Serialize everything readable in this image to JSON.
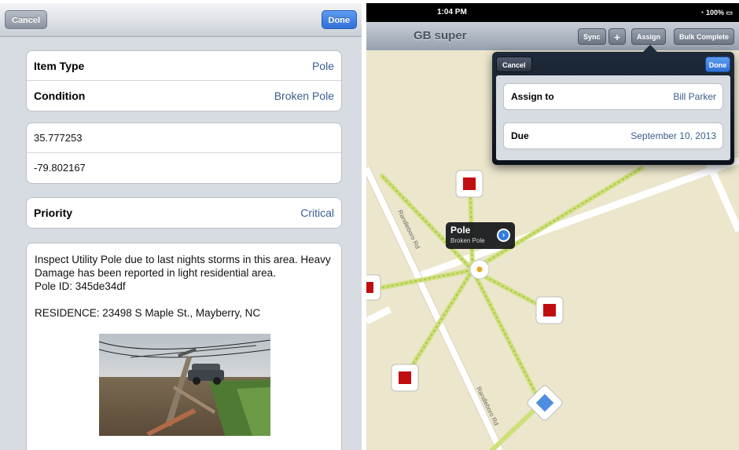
{
  "form": {
    "cancel_label": "Cancel",
    "done_label": "Done",
    "item_type": {
      "label": "Item Type",
      "value": "Pole"
    },
    "condition": {
      "label": "Condition",
      "value": "Broken Pole"
    },
    "latitude": "35.777253",
    "longitude": "-79.802167",
    "priority": {
      "label": "Priority",
      "value": "Critical"
    },
    "notes": {
      "line1": "Inspect Utility Pole due to last nights storms in this area. Heavy Damage has been reported in light residential area.",
      "line2": "Pole ID: 345de34df",
      "line3": "RESIDENCE: 23498 S Maple St., Mayberry, NC"
    }
  },
  "device": {
    "time": "1:04 PM",
    "battery": "100%"
  },
  "map_view": {
    "title": "GB super",
    "buttons": {
      "sync": "Sync",
      "add": "+",
      "assign": "Assign",
      "bulk": "Bulk Complete"
    },
    "road_labels": [
      "Randleboro Rd",
      "Randleboro Rd"
    ],
    "callout": {
      "title": "Pole",
      "subtitle": "Broken Pole"
    }
  },
  "assign_popover": {
    "cancel_label": "Cancel",
    "done_label": "Done",
    "assign_to": {
      "label": "Assign to",
      "value": "Bill Parker"
    },
    "due": {
      "label": "Due",
      "value": "September 10, 2013"
    }
  },
  "colors": {
    "accent_blue": "#2f6fd8",
    "value_blue": "#3a5d8f",
    "marker_red": "#c00d10",
    "marker_blue": "#4d8ee0",
    "line_green": "#cde07a",
    "map_bg": "#ece6cc"
  }
}
